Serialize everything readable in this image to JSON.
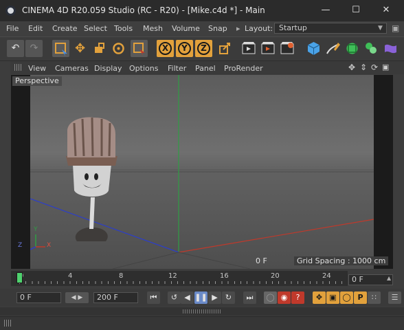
{
  "window": {
    "title": "CINEMA 4D R20.059 Studio (RC - R20) - [Mike.c4d *] - Main"
  },
  "menu": {
    "items": [
      "File",
      "Edit",
      "Create",
      "Select",
      "Tools",
      "Mesh",
      "Volume",
      "Snap"
    ]
  },
  "layout": {
    "label": "Layout:",
    "value": "Startup"
  },
  "toolbar": {
    "axis": [
      "X",
      "Y",
      "Z"
    ],
    "icons": [
      "undo-icon",
      "redo-icon",
      "live-selection-icon",
      "move-icon",
      "scale-icon",
      "rotate-icon",
      "recent-tools-icon",
      "x-axis-icon",
      "y-axis-icon",
      "z-axis-icon",
      "coordinate-system-icon",
      "render-view-icon",
      "render-to-picture-viewer-icon",
      "edit-render-settings-icon",
      "cube-icon",
      "pen-icon",
      "subdivision-icon",
      "array-icon",
      "deformer-icon"
    ]
  },
  "viewport": {
    "menu": [
      "View",
      "Cameras",
      "Display",
      "Options",
      "Filter",
      "Panel",
      "ProRender"
    ],
    "camera": "Perspective",
    "frame": "0 F",
    "grid_spacing": "Grid Spacing : 1000 cm",
    "axis_labels": {
      "y": "Y",
      "z": "Z",
      "x": "X"
    }
  },
  "timeline": {
    "ticks": [
      "0",
      "4",
      "8",
      "12",
      "16",
      "20",
      "24"
    ],
    "current_frame": "0 F"
  },
  "transport": {
    "start_field": "0 F",
    "end_field": "200 F",
    "buttons": [
      "go-to-start",
      "previous-key",
      "play-backwards",
      "pause",
      "next-key",
      "loop",
      "go-to-end"
    ]
  },
  "colors": {
    "accent": "#e2a13c",
    "playhead": "#4fd16e",
    "x_axis": "#c0392b",
    "z_axis": "#2c3ec9",
    "y_axis": "#2f9e44"
  }
}
